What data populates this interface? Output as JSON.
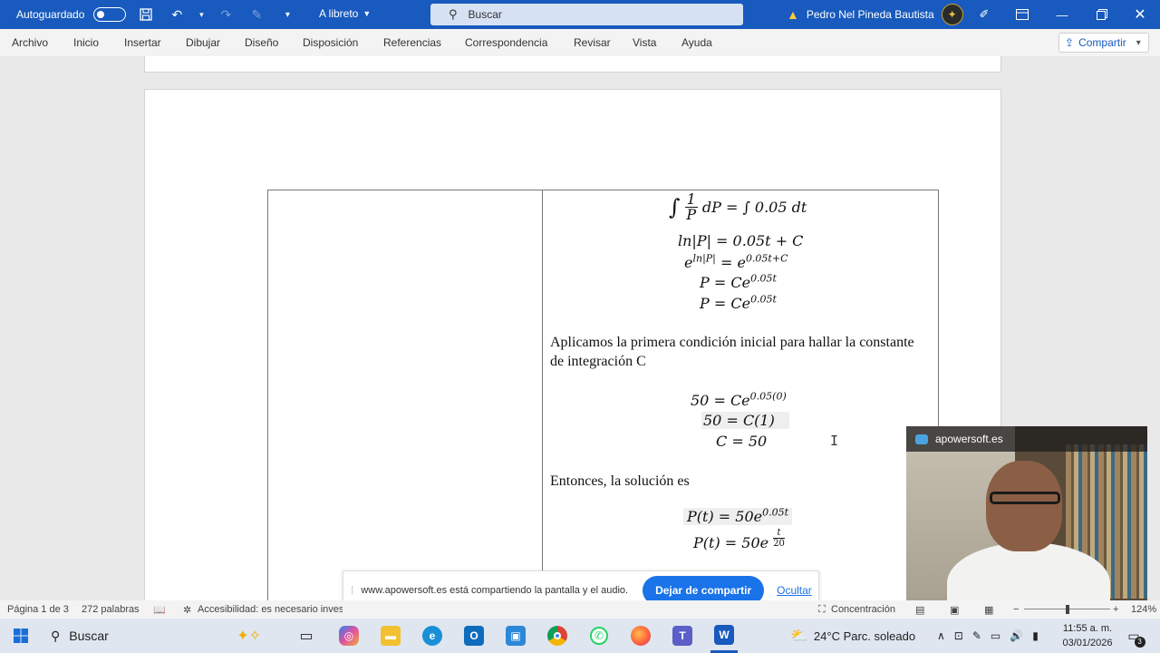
{
  "titlebar": {
    "autosave_label": "Autoguardado",
    "doc_title": "A libreto",
    "search_placeholder": "Buscar",
    "user_name": "Pedro Nel Pineda Bautista"
  },
  "ribbon": {
    "tabs": [
      "Archivo",
      "Inicio",
      "Insertar",
      "Dibujar",
      "Diseño",
      "Disposición",
      "Referencias",
      "Correspondencia",
      "Revisar",
      "Vista",
      "Ayuda"
    ],
    "share_label": "Compartir"
  },
  "document": {
    "eq1_left": "∫",
    "eq1_frac_num": "1",
    "eq1_frac_den": "P",
    "eq1_rest": "dP = ∫ 0.05 dt",
    "eq2": "ln|P| = 0.05t + C",
    "eq3_base": "e",
    "eq3_exp": "ln|P|",
    "eq3_mid": " = e",
    "eq3_exp2": "0.05t+C",
    "eq4_base": "P = Ce",
    "eq4_exp": "0.05t",
    "eq5_base": "P = Ce",
    "eq5_exp": "0.05t",
    "para1": "Aplicamos la primera condición inicial para hallar la constante de integración C",
    "eq6_base": "50 = Ce",
    "eq6_exp": "0.05(0)",
    "eq7": "50 = C(1)",
    "eq8": "C = 50",
    "para2": "Entonces, la solución es",
    "eq9_base": "P(t) = 50e",
    "eq9_exp": "0.05t",
    "eq10_base": "P(t) = 50e",
    "eq10_exp_num": "t",
    "eq10_exp_den": "20"
  },
  "webcam": {
    "source_label": "apowersoft.es"
  },
  "sharebar": {
    "message": "www.apowersoft.es está compartiendo la pantalla y el audio.",
    "stop_label": "Dejar de compartir",
    "hide_label": "Ocultar"
  },
  "statusbar": {
    "page": "Página 1 de 3",
    "words": "272 palabras",
    "accessibility": "Accesibilidad: es necesario investigar",
    "focus": "Concentración",
    "zoom": "124%"
  },
  "taskbar": {
    "search_label": "Buscar",
    "weather": "24°C  Parc. soleado",
    "time": "11:55 a. m.",
    "date": "03/01/2026",
    "notif_count": "3"
  },
  "colors": {
    "word_blue": "#185abd",
    "share_blue": "#1a73e8"
  }
}
